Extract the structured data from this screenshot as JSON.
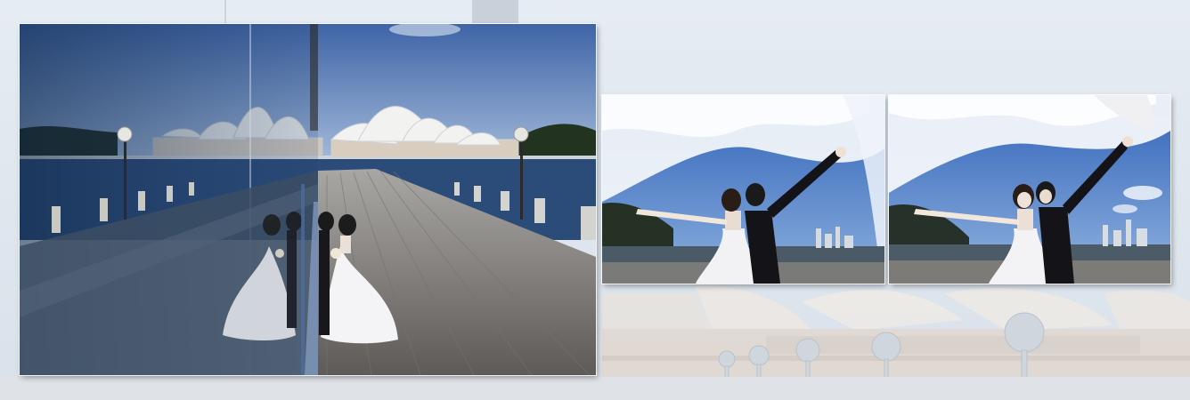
{
  "album_spread": {
    "layout": "wedding-album-spread",
    "photos": [
      {
        "id": "main",
        "scene": "couple-reflection-boardwalk-opera-house"
      },
      {
        "id": "left",
        "scene": "couple-kiss-veil-sky"
      },
      {
        "id": "right",
        "scene": "couple-smiling-veil-sky"
      }
    ]
  },
  "colors": {
    "background_sky": "#dfe6ee",
    "harbour_water": "#2e4e7a",
    "sky_blue": "#5f86c4",
    "opera_house_white": "#f2f2f0",
    "boardwalk": "#8a8580",
    "veil_white": "#f7f9fc"
  }
}
